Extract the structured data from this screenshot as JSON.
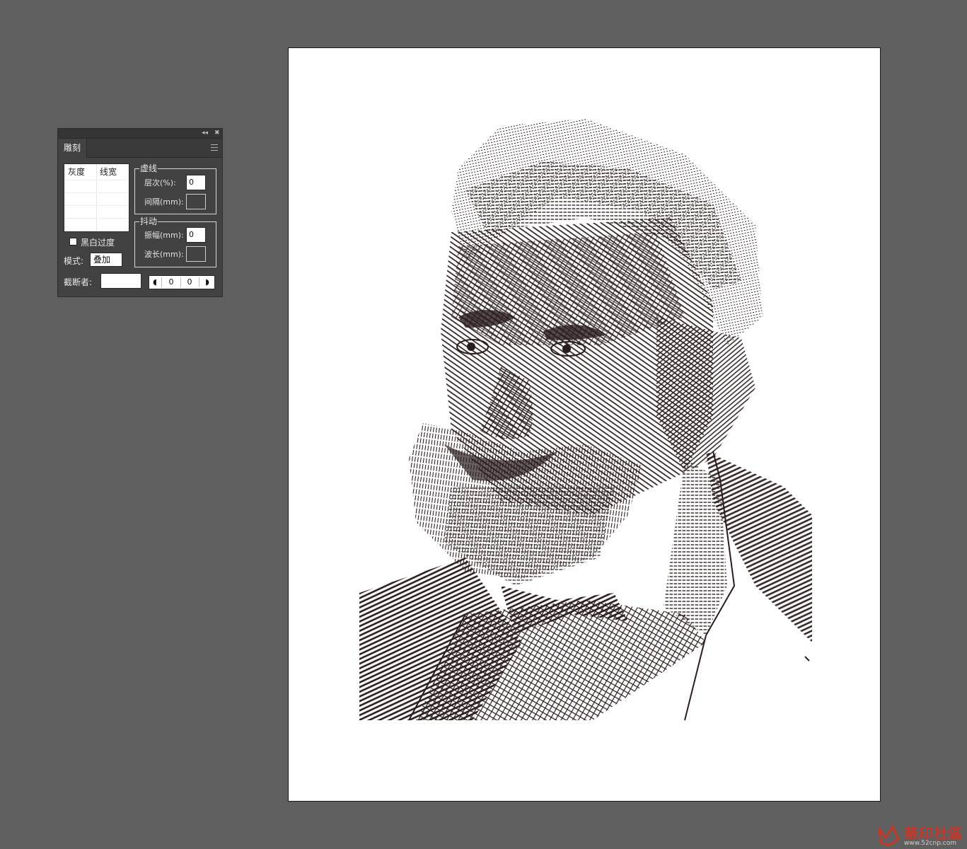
{
  "panel": {
    "title_buttons": {
      "collapse": "◂◂",
      "close": "✖"
    },
    "tab_label": "雕刻",
    "table": {
      "headers": [
        "灰度",
        "线宽"
      ]
    },
    "dash_group": {
      "title": "虚线",
      "level_label": "层次(%):",
      "level_value": "0",
      "gap_label": "间隔(mm):",
      "gap_value": ""
    },
    "jitter_group": {
      "title": "抖动",
      "amplitude_label": "振幅(mm):",
      "amplitude_value": "0",
      "wavelength_label": "波长(mm):",
      "wavelength_value": ""
    },
    "bw_transition_label": "黑白过度",
    "bw_transition_checked": false,
    "mode_label": "模式:",
    "mode_value": "叠加",
    "cutter_label": "截断者:",
    "cutter_value": "",
    "stepper": {
      "left_icon": "◖",
      "value1": "0",
      "value2": "0",
      "right_icon": "◗"
    }
  },
  "artwork": {
    "description_icon": "engraved-portrait-image",
    "ink_color": "#2a1d1d"
  },
  "watermark": {
    "text": "華印社區",
    "url": "www.52cnp.com",
    "logo_icon": "huayin-logo-icon",
    "color": "#c0392b"
  },
  "colors": {
    "workspace": "#5f5f5f",
    "panel": "#424242",
    "artboard": "#ffffff"
  }
}
